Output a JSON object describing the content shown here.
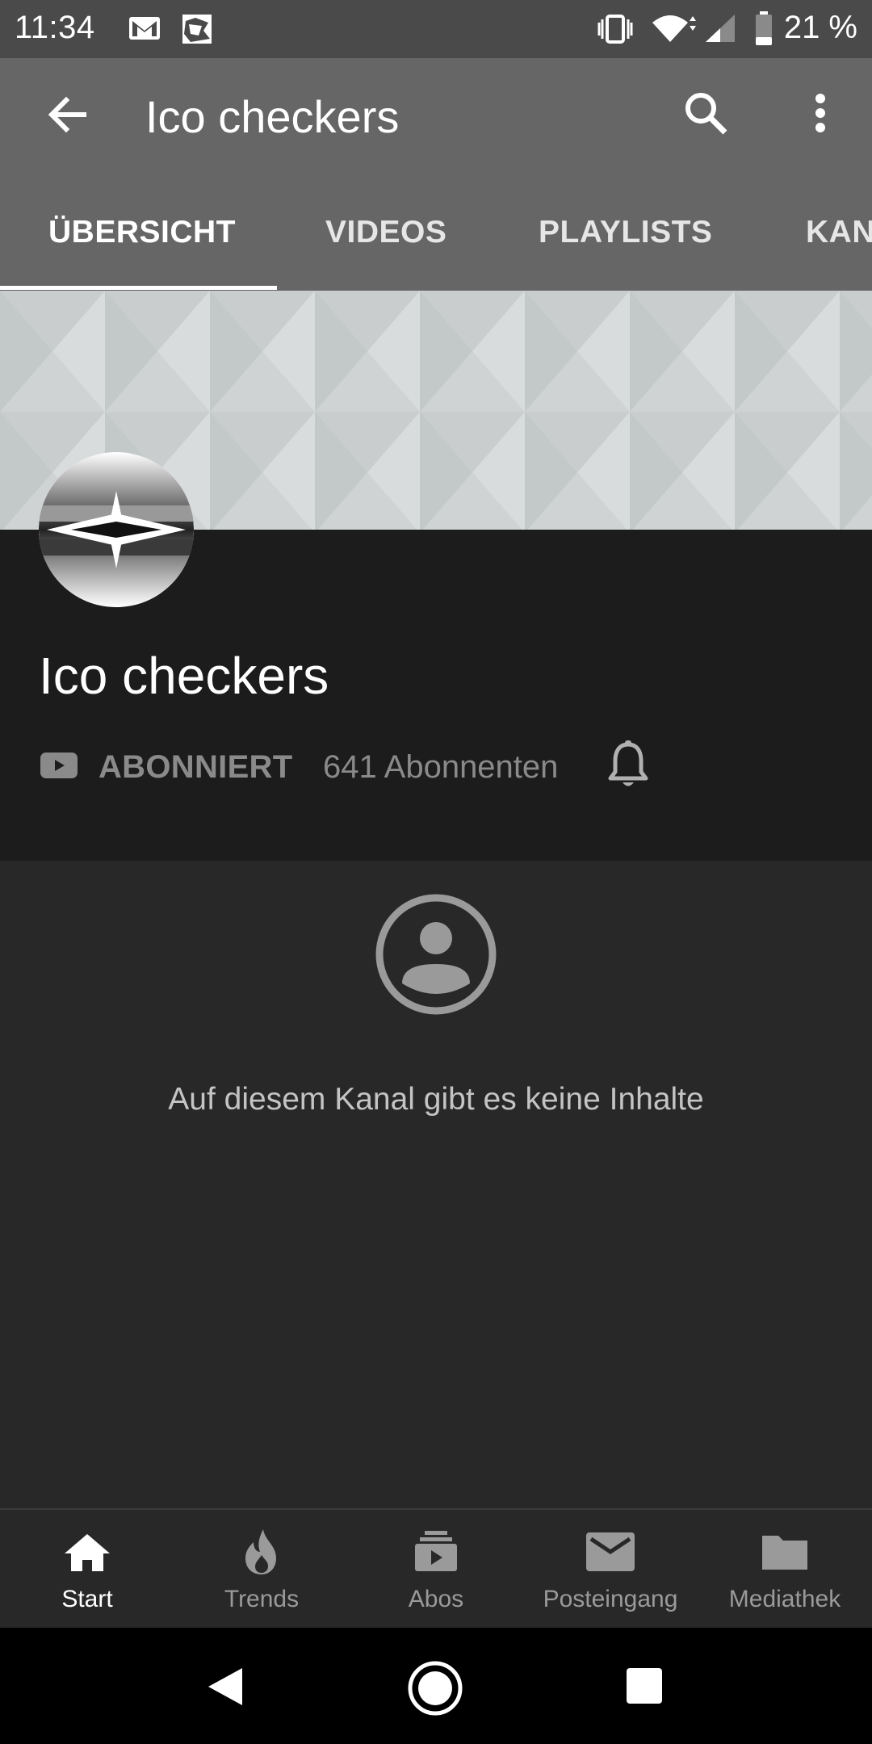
{
  "status_bar": {
    "time": "11:34",
    "battery": "21 %"
  },
  "app_bar": {
    "title": "Ico checkers",
    "tabs": [
      {
        "label": "ÜBERSICHT",
        "active": true
      },
      {
        "label": "VIDEOS",
        "active": false
      },
      {
        "label": "PLAYLISTS",
        "active": false
      },
      {
        "label": "KAN",
        "active": false
      }
    ]
  },
  "channel": {
    "name": "Ico checkers",
    "subscribed_label": "ABONNIERT",
    "subscriber_count": "641 Abonnenten"
  },
  "empty_state": {
    "text": "Auf diesem Kanal gibt es keine Inhalte"
  },
  "bottom_nav": {
    "items": [
      {
        "label": "Start",
        "icon": "home-icon",
        "active": true
      },
      {
        "label": "Trends",
        "icon": "flame-icon",
        "active": false
      },
      {
        "label": "Abos",
        "icon": "subscriptions-icon",
        "active": false
      },
      {
        "label": "Posteingang",
        "icon": "mail-icon",
        "active": false
      },
      {
        "label": "Mediathek",
        "icon": "folder-icon",
        "active": false
      }
    ]
  },
  "colors": {
    "app_bar": "#666666",
    "header": "#1c1c1c",
    "body": "#282828"
  }
}
